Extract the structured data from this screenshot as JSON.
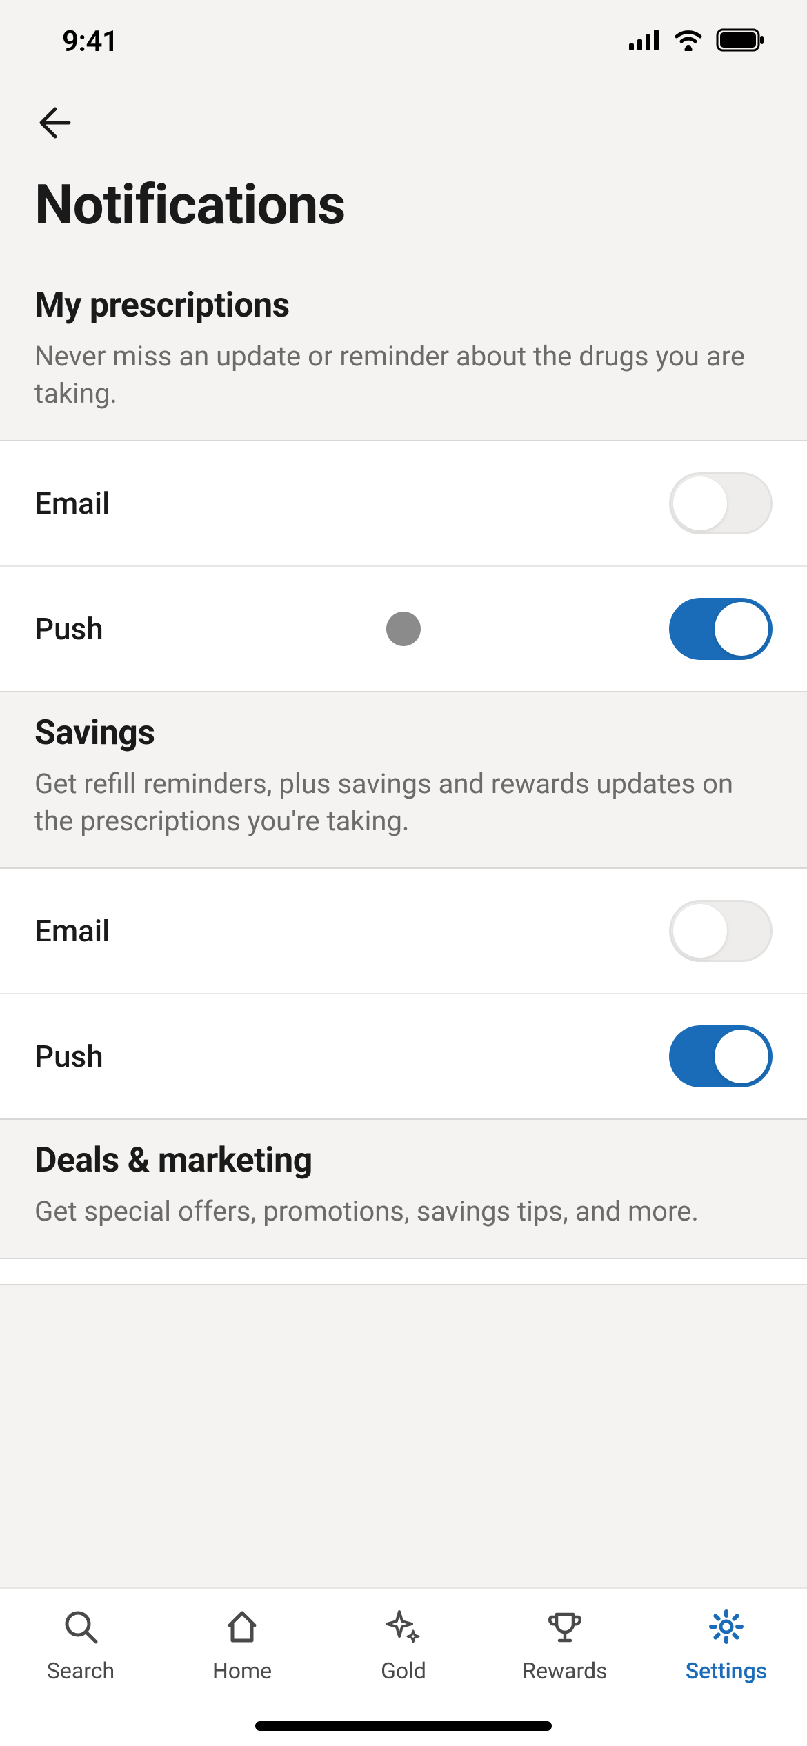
{
  "status": {
    "time": "9:41"
  },
  "page": {
    "title": "Notifications"
  },
  "sections": [
    {
      "title": "My prescriptions",
      "desc": "Never miss an update or reminder about the drugs you are taking.",
      "toggles": [
        {
          "label": "Email",
          "on": false
        },
        {
          "label": "Push",
          "on": true,
          "cursor": true
        }
      ]
    },
    {
      "title": "Savings",
      "desc": "Get refill reminders, plus savings and rewards updates on the prescriptions you're taking.",
      "toggles": [
        {
          "label": "Email",
          "on": false
        },
        {
          "label": "Push",
          "on": true
        }
      ]
    },
    {
      "title": "Deals & marketing",
      "desc": "Get special offers, promotions, savings tips, and more.",
      "toggles": []
    }
  ],
  "nav": [
    {
      "label": "Search",
      "icon": "search"
    },
    {
      "label": "Home",
      "icon": "home"
    },
    {
      "label": "Gold",
      "icon": "sparkle"
    },
    {
      "label": "Rewards",
      "icon": "trophy"
    },
    {
      "label": "Settings",
      "icon": "gear",
      "active": true
    }
  ],
  "colors": {
    "accent": "#1a6cb8"
  }
}
